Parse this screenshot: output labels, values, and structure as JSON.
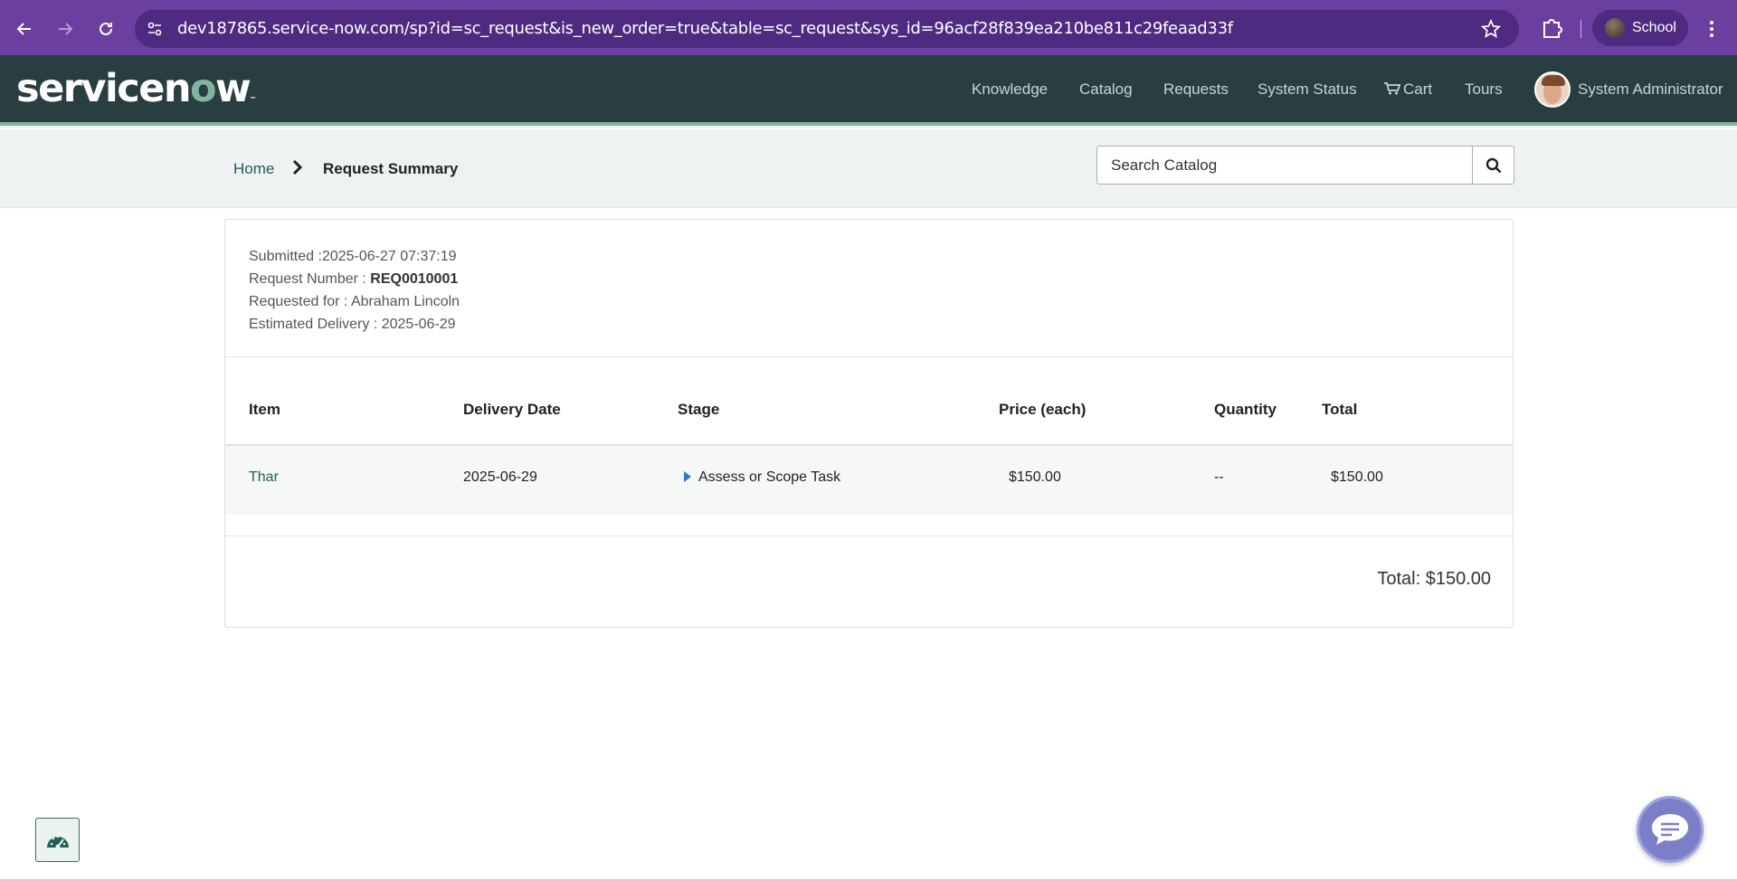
{
  "browser": {
    "url": "dev187865.service-now.com/sp?id=sc_request&is_new_order=true&table=sc_request&sys_id=96acf28f839ea210be811c29feaad33f",
    "profile_label": "School"
  },
  "header": {
    "logo_text_a": "servicen",
    "logo_text_o": "o",
    "logo_text_b": "w",
    "nav": {
      "knowledge": "Knowledge",
      "catalog": "Catalog",
      "requests": "Requests",
      "system_status": "System Status",
      "cart": "Cart",
      "tours": "Tours"
    },
    "user_name": "System Administrator"
  },
  "breadcrumb": {
    "home": "Home",
    "current": "Request Summary"
  },
  "search": {
    "placeholder": "Search Catalog"
  },
  "summary": {
    "submitted_label": "Submitted :",
    "submitted_value": "2025-06-27 07:37:19",
    "request_number_label": "Request Number : ",
    "request_number_value": "REQ0010001",
    "requested_for_label": "Requested for : ",
    "requested_for_value": "Abraham Lincoln",
    "estimated_delivery_label": "Estimated Delivery : ",
    "estimated_delivery_value": "2025-06-29"
  },
  "table": {
    "headers": {
      "item": "Item",
      "delivery_date": "Delivery Date",
      "stage": "Stage",
      "price": "Price (each)",
      "quantity": "Quantity",
      "total": "Total"
    },
    "rows": [
      {
        "item": "Thar",
        "delivery_date": "2025-06-29",
        "stage": "Assess or Scope Task",
        "price": "$150.00",
        "quantity": "--",
        "total": "$150.00"
      }
    ]
  },
  "total_text": "Total: $150.00",
  "colors": {
    "browser_bar": "#6b3fa0",
    "header_bg": "#293e40",
    "accent_green": "#81b5a1",
    "link_green": "#1f5f55"
  }
}
